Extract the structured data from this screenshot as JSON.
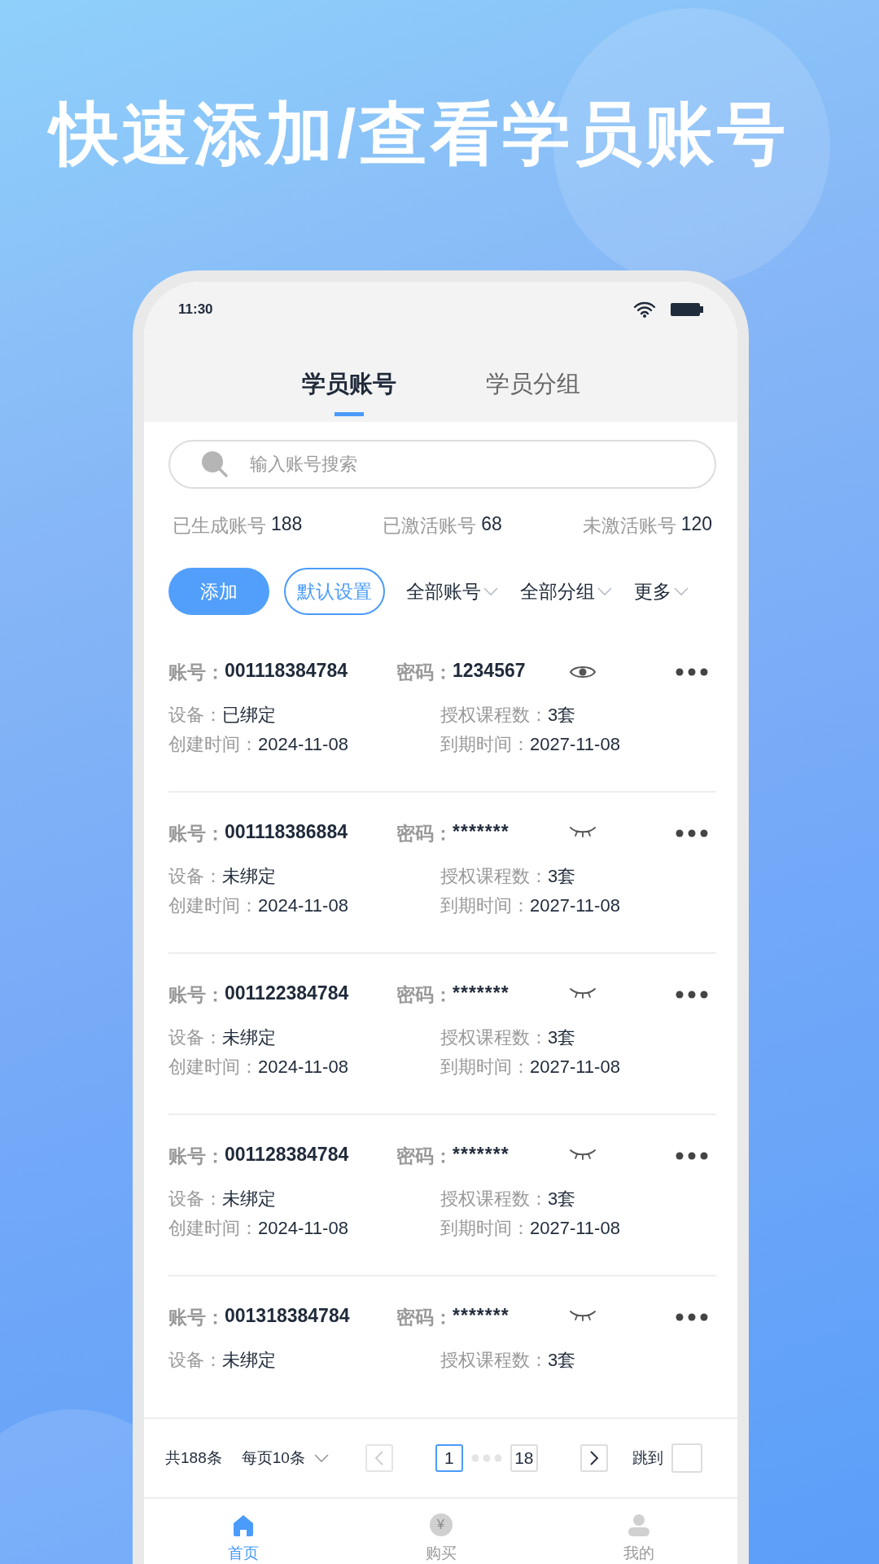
{
  "headline": "快速添加/查看学员账号",
  "status_bar": {
    "time": "11:30"
  },
  "tabs": [
    {
      "label": "学员账号",
      "selected": true
    },
    {
      "label": "学员分组",
      "selected": false
    }
  ],
  "search": {
    "placeholder": "输入账号搜索"
  },
  "stats": [
    {
      "label": "已生成账号",
      "value": "188"
    },
    {
      "label": "已激活账号",
      "value": "68"
    },
    {
      "label": "未激活账号",
      "value": "120"
    }
  ],
  "actions": [
    {
      "label": "添加",
      "kind": "primary"
    },
    {
      "label": "默认设置",
      "kind": "outline"
    }
  ],
  "filters": [
    "全部账号",
    "全部分组",
    "更多"
  ],
  "accounts": [
    {
      "account_label": "账号：",
      "account": "001118384784",
      "password_label": "密码：",
      "password": "1234567",
      "password_visible": true,
      "fields": [
        {
          "label": "设备：",
          "value": "已绑定"
        },
        {
          "label": "授权课程数：",
          "value": "3套"
        },
        {
          "label": "创建时间：",
          "value": "2024-11-08"
        },
        {
          "label": "到期时间：",
          "value": "2027-11-08"
        }
      ]
    },
    {
      "account_label": "账号：",
      "account": "001118386884",
      "password_label": "密码：",
      "password": "*******",
      "password_visible": false,
      "fields": [
        {
          "label": "设备：",
          "value": "未绑定"
        },
        {
          "label": "授权课程数：",
          "value": "3套"
        },
        {
          "label": "创建时间：",
          "value": "2024-11-08"
        },
        {
          "label": "到期时间：",
          "value": "2027-11-08"
        }
      ]
    },
    {
      "account_label": "账号：",
      "account": "001122384784",
      "password_label": "密码：",
      "password": "*******",
      "password_visible": false,
      "fields": [
        {
          "label": "设备：",
          "value": "未绑定"
        },
        {
          "label": "授权课程数：",
          "value": "3套"
        },
        {
          "label": "创建时间：",
          "value": "2024-11-08"
        },
        {
          "label": "到期时间：",
          "value": "2027-11-08"
        }
      ]
    },
    {
      "account_label": "账号：",
      "account": "001128384784",
      "password_label": "密码：",
      "password": "*******",
      "password_visible": false,
      "fields": [
        {
          "label": "设备：",
          "value": "未绑定"
        },
        {
          "label": "授权课程数：",
          "value": "3套"
        },
        {
          "label": "创建时间：",
          "value": "2024-11-08"
        },
        {
          "label": "到期时间：",
          "value": "2027-11-08"
        }
      ]
    },
    {
      "account_label": "账号：",
      "account": "001318384784",
      "password_label": "密码：",
      "password": "*******",
      "password_visible": false,
      "fields": [
        {
          "label": "设备：",
          "value": "未绑定"
        },
        {
          "label": "授权课程数：",
          "value": "3套"
        }
      ]
    }
  ],
  "pagination": {
    "total": "共188条",
    "page_size": "每页10条",
    "prev_disabled": true,
    "pages": [
      {
        "label": "1",
        "selected": true
      },
      {
        "label": "18",
        "selected": false
      }
    ],
    "jump_label": "跳到"
  },
  "nav": [
    {
      "label": "首页",
      "kind": "home",
      "selected": true
    },
    {
      "label": "购买",
      "kind": "yen",
      "glyph": "¥",
      "selected": false
    },
    {
      "label": "我的",
      "kind": "person",
      "selected": false
    }
  ]
}
